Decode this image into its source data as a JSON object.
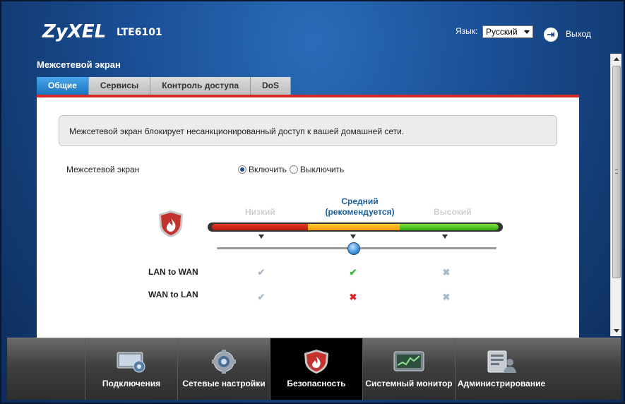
{
  "header": {
    "brand": "ZyXEL",
    "model": "LTE6101",
    "language_label": "Язык:",
    "language_value": "Русский",
    "logout_label": "Выход"
  },
  "page": {
    "title": "Межсетевой экран",
    "tabs": [
      {
        "label": "Общие",
        "active": true
      },
      {
        "label": "Сервисы",
        "active": false
      },
      {
        "label": "Контроль доступа",
        "active": false
      },
      {
        "label": "DoS",
        "active": false
      }
    ]
  },
  "content": {
    "info": "Межсетевой экран блокирует несанкционированный доступ к вашей домашней сети.",
    "firewall_label": "Межсетевой экран",
    "enable_label": "Включить",
    "disable_label": "Выключить",
    "enabled": true,
    "levels": {
      "low": "Низкий",
      "mid_line1": "Средний",
      "mid_line2": "(рекомендуется)",
      "high": "Высокий"
    },
    "selected_level": "mid",
    "rows": [
      {
        "label": "LAN to WAN",
        "low": "check",
        "mid": "check",
        "high": "cross"
      },
      {
        "label": "WAN to LAN",
        "low": "check",
        "mid": "cross",
        "high": "cross"
      }
    ],
    "colors": {
      "active_check": "#2fbf2f",
      "active_cross": "#d9262a",
      "inactive": "#a9b8c8"
    }
  },
  "nav": {
    "items": [
      {
        "label": "Подключения",
        "icon": "connections-icon",
        "active": false
      },
      {
        "label": "Сетевые настройки",
        "icon": "gear-icon",
        "active": false
      },
      {
        "label": "Безопасность",
        "icon": "shield-icon",
        "active": true
      },
      {
        "label": "Системный монитор",
        "icon": "monitor-icon",
        "active": false
      },
      {
        "label": "Администрирование",
        "icon": "admin-icon",
        "active": false
      }
    ]
  }
}
